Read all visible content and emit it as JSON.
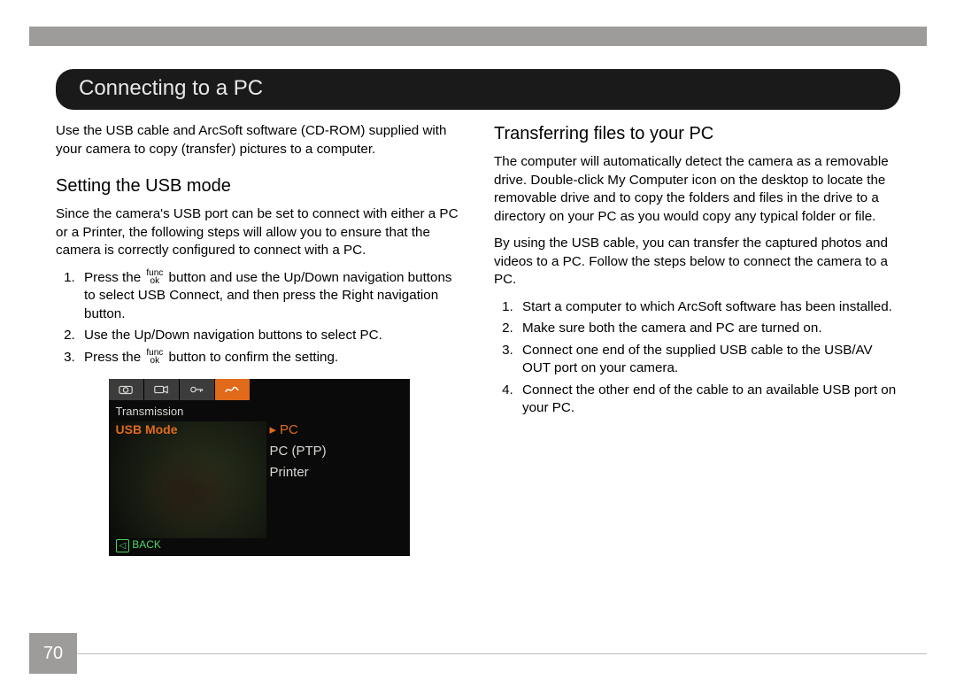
{
  "page_number": "70",
  "title": "Connecting to a PC",
  "func_label_top": "func",
  "func_label_bottom": "ok",
  "left": {
    "intro": "Use the USB cable and ArcSoft software (CD-ROM) supplied with your camera to copy (transfer) pictures to a computer.",
    "heading": "Setting the USB mode",
    "para": "Since the camera's USB port can be set to connect with either a PC or a Printer, the following steps will allow you to ensure that the camera is correctly configured to connect with a PC.",
    "step1_a": "Press the ",
    "step1_b": " button and use the Up/Down navigation buttons to select USB Connect, and then press the Right navigation button.",
    "step2": "Use the Up/Down navigation buttons to select PC.",
    "step3_a": "Press the ",
    "step3_b": " button to confirm the setting."
  },
  "right": {
    "heading": "Transferring files to your PC",
    "para1": "The computer will automatically detect the camera as a removable drive. Double-click My Computer icon on the desktop to locate the removable drive and to copy the folders and files in the drive to a directory on your PC as you would copy any typical folder or file.",
    "para2": "By using the USB cable, you can transfer the captured photos and videos to a PC. Follow the steps below to connect the camera to a PC.",
    "step1": "Start a computer to which ArcSoft software has been installed.",
    "step2": "Make sure both the camera and PC are turned on.",
    "step3": "Connect one end of the supplied USB cable to the USB/AV OUT port on your camera.",
    "step4": "Connect the other end of the cable to an available USB port on your PC."
  },
  "lcd": {
    "section": "Transmission",
    "menu": "USB Mode",
    "opt1": "PC",
    "opt2": "PC (PTP)",
    "opt3": "Printer",
    "back": "BACK"
  }
}
